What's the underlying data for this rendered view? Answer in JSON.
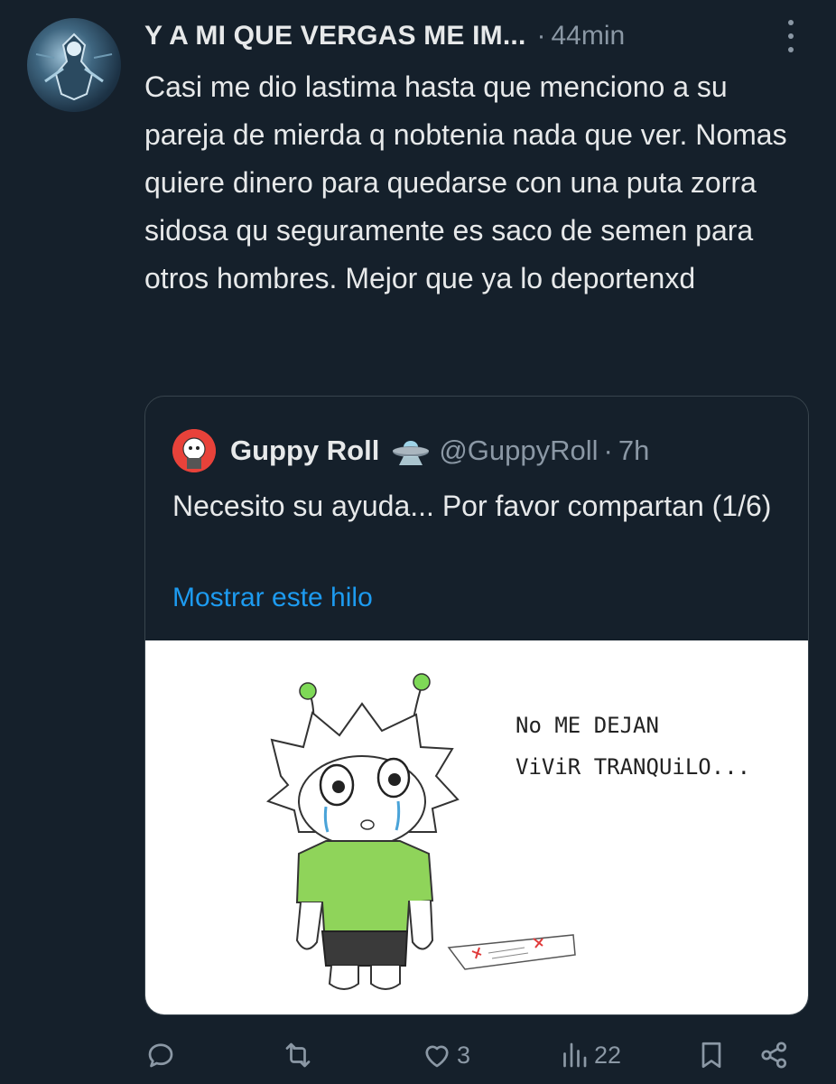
{
  "tweet": {
    "author": "Y A MI QUE VERGAS ME IM...",
    "separator": "·",
    "time": "44min",
    "text": "Casi me dio lastima hasta que menciono a su pareja de mierda q nobtenia nada que ver. Nomas quiere dinero para quedarse con una puta zorra sidosa qu seguramente es saco de semen para otros hombres. Mejor que ya lo deportenxd"
  },
  "quoted": {
    "name": "Guppy Roll",
    "handle": "@GuppyRoll",
    "separator": "·",
    "time": "7h",
    "text": "Necesito su ayuda... Por favor compartan (1/6)",
    "link": "Mostrar este hilo",
    "image_text": [
      "No ME DEJAN",
      "ViViR TRANQUiLO..."
    ]
  },
  "actions": {
    "reply_count": "",
    "retweet_count": "",
    "like_count": "3",
    "views_count": "22"
  },
  "colors": {
    "background": "#15202b",
    "text": "#e7e9ea",
    "muted": "#8b98a5",
    "link": "#1d9bf0",
    "border": "#38444d"
  }
}
